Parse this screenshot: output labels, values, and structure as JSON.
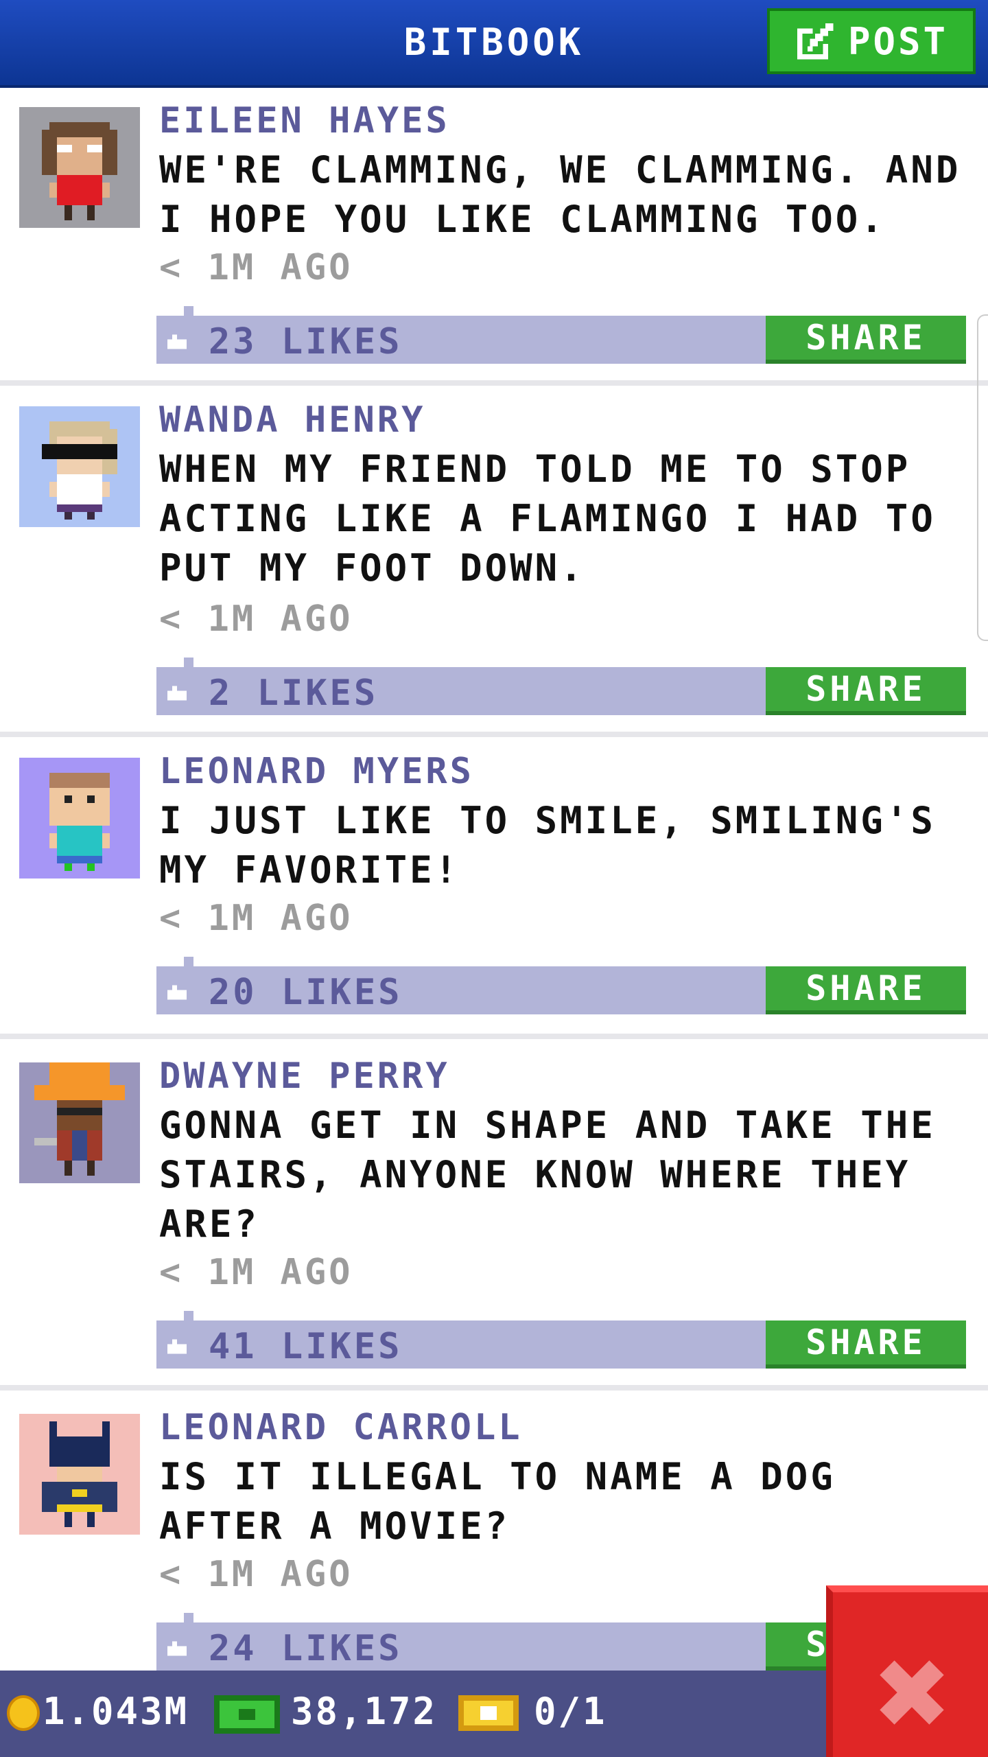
{
  "header": {
    "title": "BITBOOK",
    "post_label": "POST",
    "post_icon": "compose-icon"
  },
  "posts": [
    {
      "author": "EILEEN HAYES",
      "text": "WE'RE CLAMMING, WE CLAMMING. AND I HOPE YOU LIKE CLAMMING TOO.",
      "time": "< 1M AGO",
      "likes": "23 LIKES",
      "share": "SHARE",
      "avatar_bg": "#9e9ea4"
    },
    {
      "author": "WANDA HENRY",
      "text": "WHEN MY FRIEND TOLD ME TO STOP ACTING LIKE A FLAMINGO I HAD TO PUT MY FOOT DOWN.",
      "time": "< 1M AGO",
      "likes": "2 LIKES",
      "share": "SHARE",
      "avatar_bg": "#aec4f4"
    },
    {
      "author": "LEONARD MYERS",
      "text": "I JUST LIKE TO SMILE, SMILING'S MY FAVORITE!",
      "time": "< 1M AGO",
      "likes": "20 LIKES",
      "share": "SHARE",
      "avatar_bg": "#a696f6"
    },
    {
      "author": "DWAYNE PERRY",
      "text": "GONNA GET IN SHAPE AND TAKE THE STAIRS, ANYONE KNOW WHERE THEY ARE?",
      "time": "< 1M AGO",
      "likes": "41 LIKES",
      "share": "SHARE",
      "avatar_bg": "#9a96bc"
    },
    {
      "author": "LEONARD CARROLL",
      "text": "IS IT ILLEGAL TO NAME A DOG AFTER A MOVIE?",
      "time": "< 1M AGO",
      "likes": "24 LIKES",
      "share": "SHARE",
      "avatar_bg": "#f4beb8"
    }
  ],
  "status": {
    "coins": "1.043M",
    "bux": "38,172",
    "tickets": "0/1"
  },
  "close": {
    "icon": "close-icon"
  },
  "colors": {
    "header": "#1a46b8",
    "accent_green": "#2fb52f",
    "likes_bar": "#b2b4d8",
    "close_red": "#e02626"
  }
}
